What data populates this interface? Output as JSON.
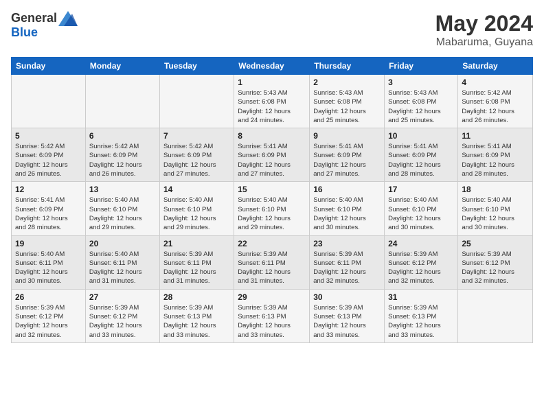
{
  "header": {
    "logo_general": "General",
    "logo_blue": "Blue",
    "month_year": "May 2024",
    "location": "Mabaruma, Guyana"
  },
  "days_of_week": [
    "Sunday",
    "Monday",
    "Tuesday",
    "Wednesday",
    "Thursday",
    "Friday",
    "Saturday"
  ],
  "weeks": [
    [
      {
        "day": "",
        "info": ""
      },
      {
        "day": "",
        "info": ""
      },
      {
        "day": "",
        "info": ""
      },
      {
        "day": "1",
        "info": "Sunrise: 5:43 AM\nSunset: 6:08 PM\nDaylight: 12 hours\nand 24 minutes."
      },
      {
        "day": "2",
        "info": "Sunrise: 5:43 AM\nSunset: 6:08 PM\nDaylight: 12 hours\nand 25 minutes."
      },
      {
        "day": "3",
        "info": "Sunrise: 5:43 AM\nSunset: 6:08 PM\nDaylight: 12 hours\nand 25 minutes."
      },
      {
        "day": "4",
        "info": "Sunrise: 5:42 AM\nSunset: 6:08 PM\nDaylight: 12 hours\nand 26 minutes."
      }
    ],
    [
      {
        "day": "5",
        "info": "Sunrise: 5:42 AM\nSunset: 6:09 PM\nDaylight: 12 hours\nand 26 minutes."
      },
      {
        "day": "6",
        "info": "Sunrise: 5:42 AM\nSunset: 6:09 PM\nDaylight: 12 hours\nand 26 minutes."
      },
      {
        "day": "7",
        "info": "Sunrise: 5:42 AM\nSunset: 6:09 PM\nDaylight: 12 hours\nand 27 minutes."
      },
      {
        "day": "8",
        "info": "Sunrise: 5:41 AM\nSunset: 6:09 PM\nDaylight: 12 hours\nand 27 minutes."
      },
      {
        "day": "9",
        "info": "Sunrise: 5:41 AM\nSunset: 6:09 PM\nDaylight: 12 hours\nand 27 minutes."
      },
      {
        "day": "10",
        "info": "Sunrise: 5:41 AM\nSunset: 6:09 PM\nDaylight: 12 hours\nand 28 minutes."
      },
      {
        "day": "11",
        "info": "Sunrise: 5:41 AM\nSunset: 6:09 PM\nDaylight: 12 hours\nand 28 minutes."
      }
    ],
    [
      {
        "day": "12",
        "info": "Sunrise: 5:41 AM\nSunset: 6:09 PM\nDaylight: 12 hours\nand 28 minutes."
      },
      {
        "day": "13",
        "info": "Sunrise: 5:40 AM\nSunset: 6:10 PM\nDaylight: 12 hours\nand 29 minutes."
      },
      {
        "day": "14",
        "info": "Sunrise: 5:40 AM\nSunset: 6:10 PM\nDaylight: 12 hours\nand 29 minutes."
      },
      {
        "day": "15",
        "info": "Sunrise: 5:40 AM\nSunset: 6:10 PM\nDaylight: 12 hours\nand 29 minutes."
      },
      {
        "day": "16",
        "info": "Sunrise: 5:40 AM\nSunset: 6:10 PM\nDaylight: 12 hours\nand 30 minutes."
      },
      {
        "day": "17",
        "info": "Sunrise: 5:40 AM\nSunset: 6:10 PM\nDaylight: 12 hours\nand 30 minutes."
      },
      {
        "day": "18",
        "info": "Sunrise: 5:40 AM\nSunset: 6:10 PM\nDaylight: 12 hours\nand 30 minutes."
      }
    ],
    [
      {
        "day": "19",
        "info": "Sunrise: 5:40 AM\nSunset: 6:11 PM\nDaylight: 12 hours\nand 30 minutes."
      },
      {
        "day": "20",
        "info": "Sunrise: 5:40 AM\nSunset: 6:11 PM\nDaylight: 12 hours\nand 31 minutes."
      },
      {
        "day": "21",
        "info": "Sunrise: 5:39 AM\nSunset: 6:11 PM\nDaylight: 12 hours\nand 31 minutes."
      },
      {
        "day": "22",
        "info": "Sunrise: 5:39 AM\nSunset: 6:11 PM\nDaylight: 12 hours\nand 31 minutes."
      },
      {
        "day": "23",
        "info": "Sunrise: 5:39 AM\nSunset: 6:11 PM\nDaylight: 12 hours\nand 32 minutes."
      },
      {
        "day": "24",
        "info": "Sunrise: 5:39 AM\nSunset: 6:12 PM\nDaylight: 12 hours\nand 32 minutes."
      },
      {
        "day": "25",
        "info": "Sunrise: 5:39 AM\nSunset: 6:12 PM\nDaylight: 12 hours\nand 32 minutes."
      }
    ],
    [
      {
        "day": "26",
        "info": "Sunrise: 5:39 AM\nSunset: 6:12 PM\nDaylight: 12 hours\nand 32 minutes."
      },
      {
        "day": "27",
        "info": "Sunrise: 5:39 AM\nSunset: 6:12 PM\nDaylight: 12 hours\nand 33 minutes."
      },
      {
        "day": "28",
        "info": "Sunrise: 5:39 AM\nSunset: 6:13 PM\nDaylight: 12 hours\nand 33 minutes."
      },
      {
        "day": "29",
        "info": "Sunrise: 5:39 AM\nSunset: 6:13 PM\nDaylight: 12 hours\nand 33 minutes."
      },
      {
        "day": "30",
        "info": "Sunrise: 5:39 AM\nSunset: 6:13 PM\nDaylight: 12 hours\nand 33 minutes."
      },
      {
        "day": "31",
        "info": "Sunrise: 5:39 AM\nSunset: 6:13 PM\nDaylight: 12 hours\nand 33 minutes."
      },
      {
        "day": "",
        "info": ""
      }
    ]
  ]
}
